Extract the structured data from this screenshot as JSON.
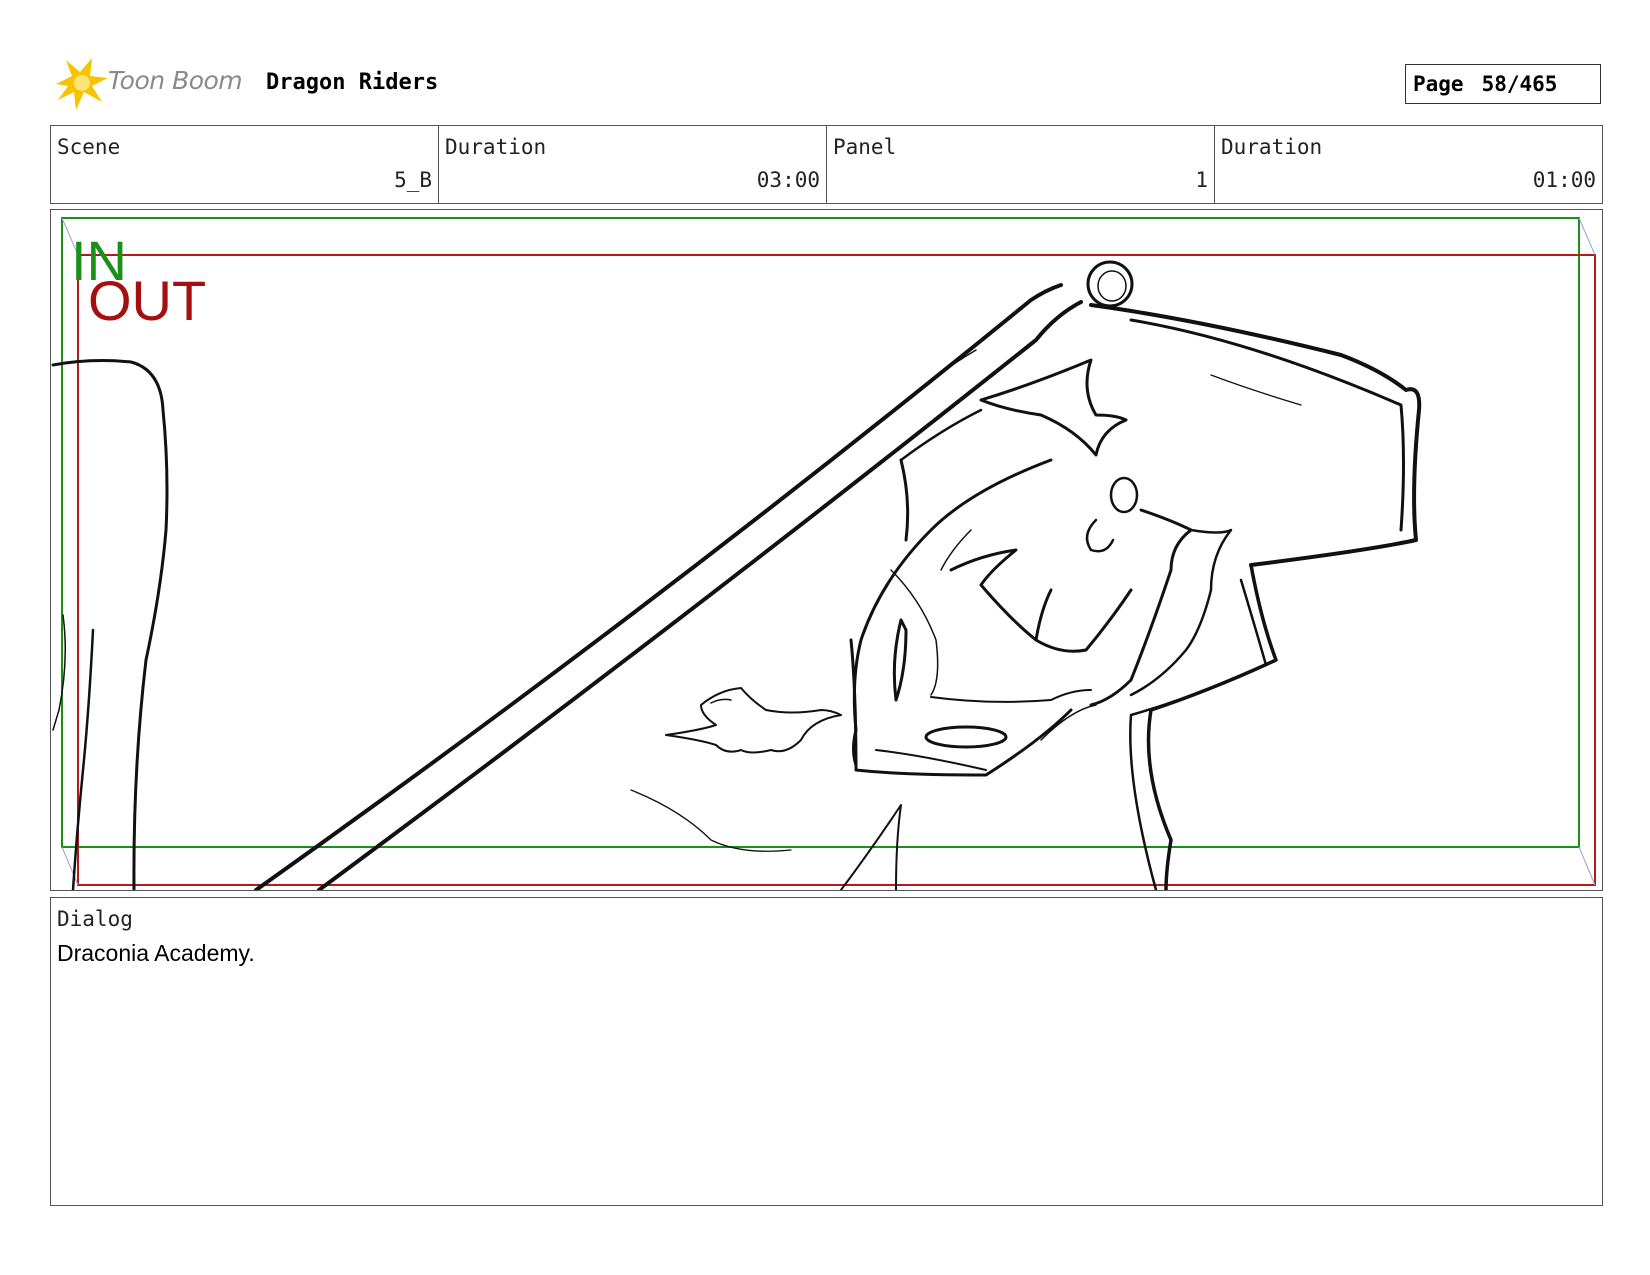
{
  "header": {
    "logo_text": "Toon Boom",
    "project_title": "Dragon Riders",
    "page_label": "Page",
    "page_value": "58/465"
  },
  "info": {
    "scene_label": "Scene",
    "scene_value": "5_B",
    "scene_duration_label": "Duration",
    "scene_duration_value": "03:00",
    "panel_label": "Panel",
    "panel_value": "1",
    "panel_duration_label": "Duration",
    "panel_duration_value": "01:00"
  },
  "panel": {
    "in_label": "IN",
    "out_label": "OUT",
    "in_color": "#1a8f1a",
    "out_color": "#a50f0f"
  },
  "dialog": {
    "label": "Dialog",
    "text": "Draconia Academy."
  },
  "colors": {
    "logo_star": "#f7c400",
    "frame_border": "#555555"
  }
}
